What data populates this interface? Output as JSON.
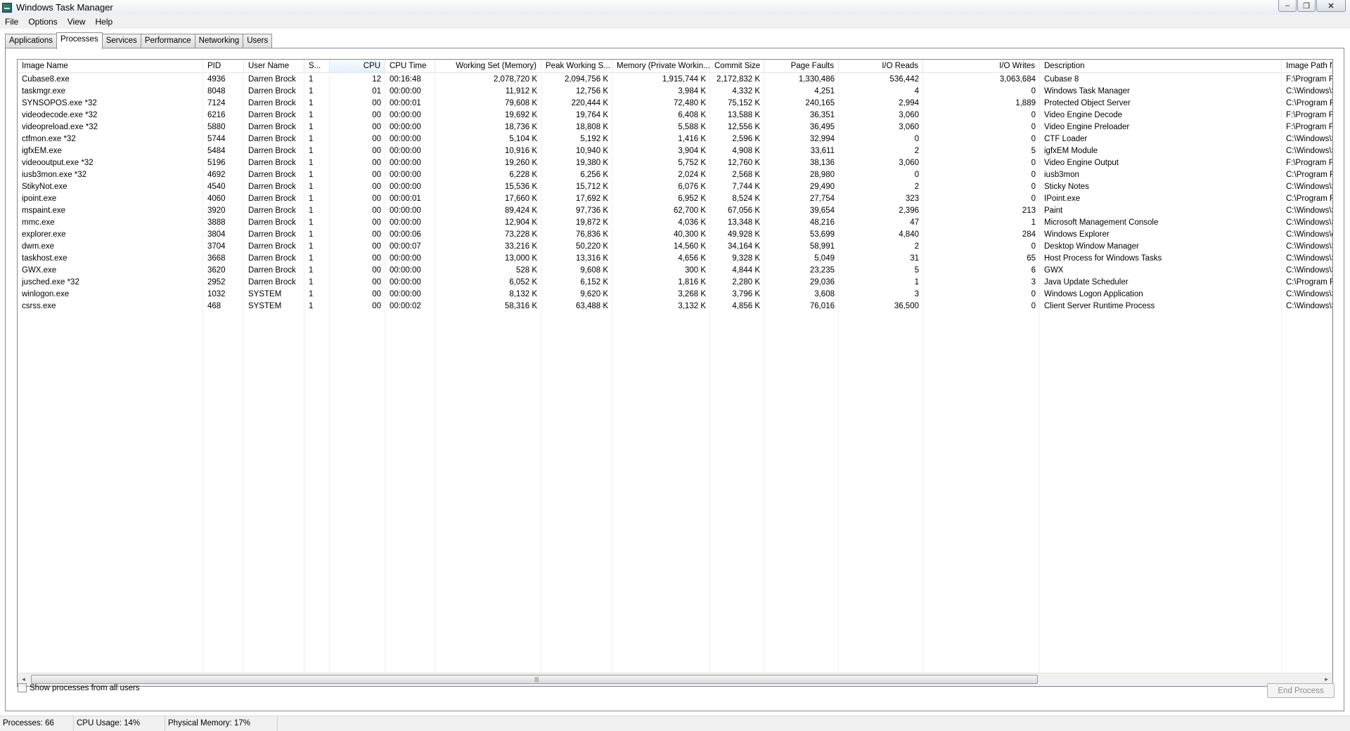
{
  "window": {
    "title": "Windows Task Manager"
  },
  "controls": {
    "minimize": "–",
    "maximize": "❐",
    "close": "✕"
  },
  "menu": [
    "File",
    "Options",
    "View",
    "Help"
  ],
  "tabs": [
    {
      "label": "Applications",
      "active": false
    },
    {
      "label": "Processes",
      "active": true
    },
    {
      "label": "Services",
      "active": false
    },
    {
      "label": "Performance",
      "active": false
    },
    {
      "label": "Networking",
      "active": false
    },
    {
      "label": "Users",
      "active": false
    }
  ],
  "columns": [
    "Image Name",
    "PID",
    "User Name",
    "S...",
    "CPU",
    "CPU Time",
    "Working Set (Memory)",
    "Peak Working S...",
    "Memory (Private Workin...",
    "Commit Size",
    "Page Faults",
    "I/O Reads",
    "I/O Writes",
    "Description",
    "Image Path Na"
  ],
  "sorted_column": "CPU",
  "processes": [
    [
      "Cubase8.exe",
      "4936",
      "Darren Brock",
      "1",
      "12",
      "00:16:48",
      "2,078,720 K",
      "2,094,756 K",
      "1,915,744 K",
      "2,172,832 K",
      "1,330,486",
      "536,442",
      "3,063,684",
      "Cubase 8",
      "F:\\Program File"
    ],
    [
      "taskmgr.exe",
      "8048",
      "Darren Brock",
      "1",
      "01",
      "00:00:00",
      "11,912 K",
      "12,756 K",
      "3,984 K",
      "4,332 K",
      "4,251",
      "4",
      "0",
      "Windows Task Manager",
      "C:\\Windows\\Sy"
    ],
    [
      "SYNSOPOS.exe *32",
      "7124",
      "Darren Brock",
      "1",
      "00",
      "00:00:01",
      "79,608 K",
      "220,444 K",
      "72,480 K",
      "75,152 K",
      "240,165",
      "2,994",
      "1,889",
      "Protected Object Server",
      "C:\\Program File"
    ],
    [
      "videodecode.exe *32",
      "6216",
      "Darren Brock",
      "1",
      "00",
      "00:00:00",
      "19,692 K",
      "19,764 K",
      "6,408 K",
      "13,588 K",
      "36,351",
      "3,060",
      "0",
      "Video Engine Decode",
      "F:\\Program File"
    ],
    [
      "videopreload.exe *32",
      "5880",
      "Darren Brock",
      "1",
      "00",
      "00:00:00",
      "18,736 K",
      "18,808 K",
      "5,588 K",
      "12,556 K",
      "36,495",
      "3,060",
      "0",
      "Video Engine Preloader",
      "F:\\Program File"
    ],
    [
      "ctfmon.exe *32",
      "5744",
      "Darren Brock",
      "1",
      "00",
      "00:00:00",
      "5,104 K",
      "5,192 K",
      "1,416 K",
      "2,596 K",
      "32,994",
      "0",
      "0",
      "CTF Loader",
      "C:\\Windows\\Sy"
    ],
    [
      "igfxEM.exe",
      "5484",
      "Darren Brock",
      "1",
      "00",
      "00:00:00",
      "10,916 K",
      "10,940 K",
      "3,904 K",
      "4,908 K",
      "33,611",
      "2",
      "5",
      "igfxEM Module",
      "C:\\Windows\\Sy"
    ],
    [
      "videooutput.exe *32",
      "5196",
      "Darren Brock",
      "1",
      "00",
      "00:00:00",
      "19,260 K",
      "19,380 K",
      "5,752 K",
      "12,760 K",
      "38,136",
      "3,060",
      "0",
      "Video Engine Output",
      "F:\\Program File"
    ],
    [
      "iusb3mon.exe *32",
      "4692",
      "Darren Brock",
      "1",
      "00",
      "00:00:00",
      "6,228 K",
      "6,256 K",
      "2,024 K",
      "2,568 K",
      "28,980",
      "0",
      "0",
      "iusb3mon",
      "C:\\Program File"
    ],
    [
      "StikyNot.exe",
      "4540",
      "Darren Brock",
      "1",
      "00",
      "00:00:00",
      "15,536 K",
      "15,712 K",
      "6,076 K",
      "7,744 K",
      "29,490",
      "2",
      "0",
      "Sticky Notes",
      "C:\\Windows\\Sy"
    ],
    [
      "ipoint.exe",
      "4060",
      "Darren Brock",
      "1",
      "00",
      "00:00:01",
      "17,660 K",
      "17,692 K",
      "6,952 K",
      "8,524 K",
      "27,754",
      "323",
      "0",
      "IPoint.exe",
      "C:\\Program File"
    ],
    [
      "mspaint.exe",
      "3920",
      "Darren Brock",
      "1",
      "00",
      "00:00:00",
      "89,424 K",
      "97,736 K",
      "62,700 K",
      "67,056 K",
      "39,654",
      "2,396",
      "213",
      "Paint",
      "C:\\Windows\\Sy"
    ],
    [
      "mmc.exe",
      "3888",
      "Darren Brock",
      "1",
      "00",
      "00:00:00",
      "12,904 K",
      "19,872 K",
      "4,036 K",
      "13,348 K",
      "48,216",
      "47",
      "1",
      "Microsoft Management Console",
      "C:\\Windows\\Sy"
    ],
    [
      "explorer.exe",
      "3804",
      "Darren Brock",
      "1",
      "00",
      "00:00:06",
      "73,228 K",
      "76,836 K",
      "40,300 K",
      "49,928 K",
      "53,699",
      "4,840",
      "284",
      "Windows Explorer",
      "C:\\Windows\\ex"
    ],
    [
      "dwm.exe",
      "3704",
      "Darren Brock",
      "1",
      "00",
      "00:00:07",
      "33,216 K",
      "50,220 K",
      "14,560 K",
      "34,164 K",
      "58,991",
      "2",
      "0",
      "Desktop Window Manager",
      "C:\\Windows\\Sy"
    ],
    [
      "taskhost.exe",
      "3668",
      "Darren Brock",
      "1",
      "00",
      "00:00:00",
      "13,000 K",
      "13,316 K",
      "4,656 K",
      "9,328 K",
      "5,049",
      "31",
      "65",
      "Host Process for Windows Tasks",
      "C:\\Windows\\Sy"
    ],
    [
      "GWX.exe",
      "3620",
      "Darren Brock",
      "1",
      "00",
      "00:00:00",
      "528 K",
      "9,608 K",
      "300 K",
      "4,844 K",
      "23,235",
      "5",
      "6",
      "GWX",
      "C:\\Windows\\Sy"
    ],
    [
      "jusched.exe *32",
      "2952",
      "Darren Brock",
      "1",
      "00",
      "00:00:00",
      "6,052 K",
      "6,152 K",
      "1,816 K",
      "2,280 K",
      "29,036",
      "1",
      "3",
      "Java Update Scheduler",
      "C:\\Program File"
    ],
    [
      "winlogon.exe",
      "1032",
      "SYSTEM",
      "1",
      "00",
      "00:00:00",
      "8,132 K",
      "9,620 K",
      "3,268 K",
      "3,796 K",
      "3,608",
      "3",
      "0",
      "Windows Logon Application",
      "C:\\Windows\\Sy"
    ],
    [
      "csrss.exe",
      "468",
      "SYSTEM",
      "1",
      "00",
      "00:00:02",
      "58,316 K",
      "63,488 K",
      "3,132 K",
      "4,856 K",
      "76,016",
      "36,500",
      "0",
      "Client Server Runtime Process",
      "C:\\Windows\\Sy"
    ]
  ],
  "scrollbar": {
    "left_arrow": "◂",
    "right_arrow": "▸",
    "grip": "|||"
  },
  "footer": {
    "show_all_label": "Show processes from all users",
    "end_process_label": "End Process"
  },
  "status": {
    "processes": "Processes: 66",
    "cpu": "CPU Usage: 14%",
    "memory": "Physical Memory: 17%"
  }
}
